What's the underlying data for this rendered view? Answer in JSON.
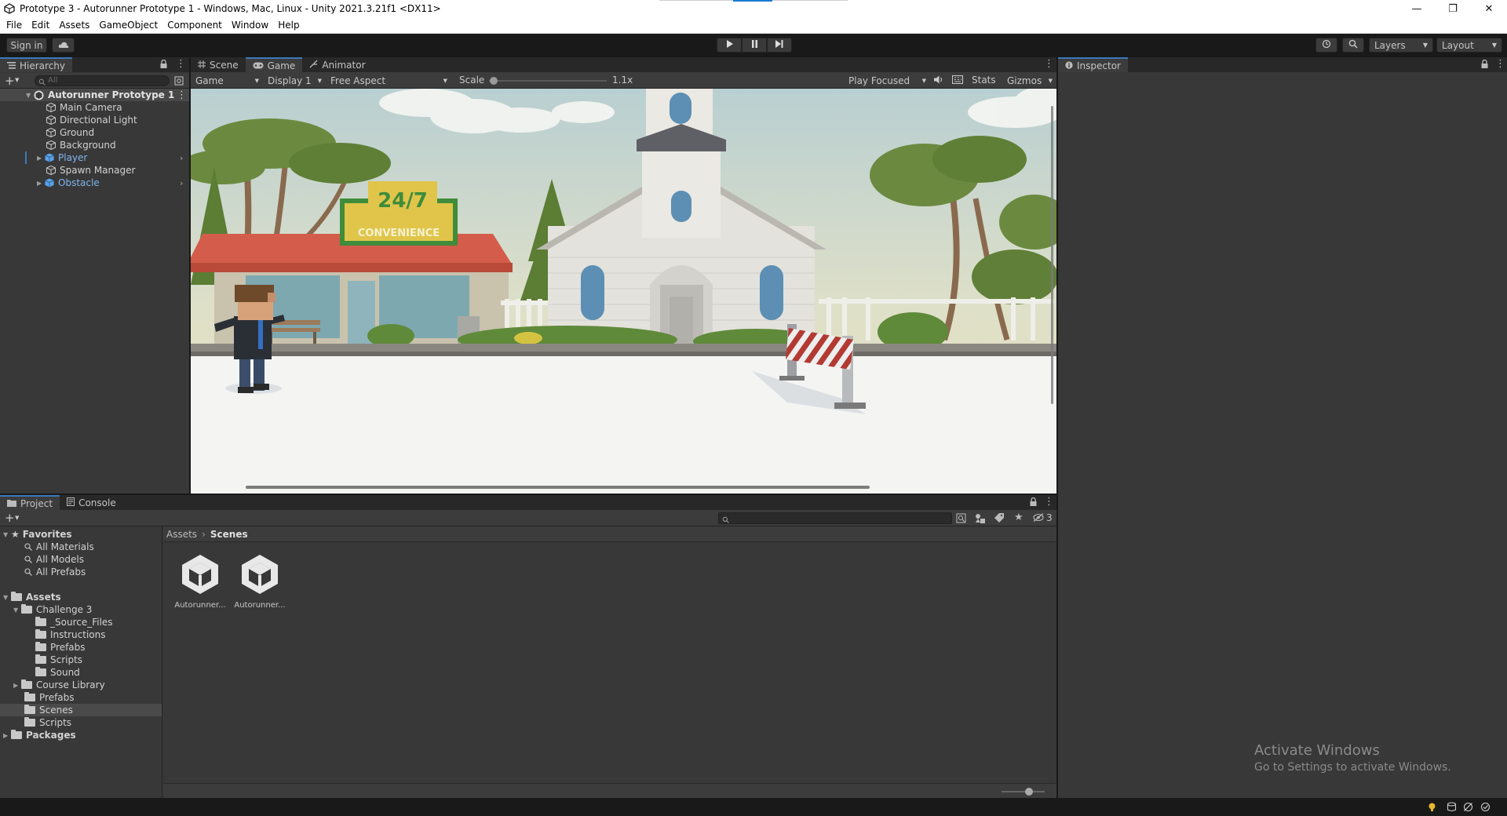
{
  "window": {
    "title": "Prototype 3 - Autorunner Prototype 1 - Windows, Mac, Linux - Unity 2021.3.21f1 <DX11>"
  },
  "menu": [
    "File",
    "Edit",
    "Assets",
    "GameObject",
    "Component",
    "Window",
    "Help"
  ],
  "toolbar": {
    "signin": "Sign in",
    "layers": "Layers",
    "layout": "Layout"
  },
  "hierarchy": {
    "tab": "Hierarchy",
    "search_placeholder": "All",
    "scene": "Autorunner Prototype 1",
    "items": [
      {
        "label": "Main Camera",
        "prefab": false
      },
      {
        "label": "Directional Light",
        "prefab": false
      },
      {
        "label": "Ground",
        "prefab": false
      },
      {
        "label": "Background",
        "prefab": false
      },
      {
        "label": "Player",
        "prefab": true
      },
      {
        "label": "Spawn Manager",
        "prefab": false
      },
      {
        "label": "Obstacle",
        "prefab": true
      }
    ]
  },
  "view_tabs": {
    "scene": "Scene",
    "game": "Game",
    "animator": "Animator"
  },
  "game_toolbar": {
    "mode": "Game",
    "display": "Display 1",
    "aspect": "Free Aspect",
    "scale_label": "Scale",
    "scale_value": "1.1x",
    "play_focused": "Play Focused",
    "stats": "Stats",
    "gizmos": "Gizmos"
  },
  "scene_content": {
    "sign_top": "24/7",
    "sign_bottom": "CONVENIENCE"
  },
  "inspector": {
    "tab": "Inspector"
  },
  "project": {
    "tab_project": "Project",
    "tab_console": "Console",
    "hidden_count": "3",
    "breadcrumb": [
      "Assets",
      "Scenes"
    ],
    "favorites": {
      "label": "Favorites",
      "items": [
        "All Materials",
        "All Models",
        "All Prefabs"
      ]
    },
    "assets": {
      "label": "Assets",
      "challenge": "Challenge 3",
      "challenge_children": [
        "_Source_Files",
        "Instructions",
        "Prefabs",
        "Scripts",
        "Sound"
      ],
      "course_library": "Course Library",
      "prefabs": "Prefabs",
      "scenes": "Scenes",
      "scripts": "Scripts"
    },
    "packages": "Packages",
    "files": [
      "Autorunner...",
      "Autorunner..."
    ]
  },
  "watermark": {
    "line1": "Activate Windows",
    "line2": "Go to Settings to activate Windows."
  },
  "colors": {
    "accent": "#3a79bb",
    "prefab_text": "#7fb4ef",
    "panel_bg": "#383838",
    "sky": "#d3dcc8"
  }
}
